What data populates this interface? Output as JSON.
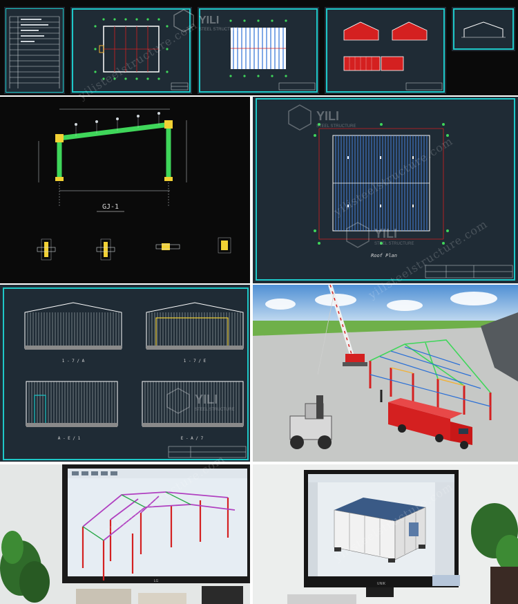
{
  "drawings": {
    "roof_plan_title": "Roof Plan",
    "frame_title": "GJ-1",
    "elevation_captions": [
      "1 - 7 / A",
      "1 - 7 / E",
      "A - E / 1",
      "E - A / 7"
    ]
  },
  "branding": {
    "logo_name": "YILI",
    "logo_sub": "STEEL STRUCTURE",
    "watermark_url": "yilisteelstructure.com"
  },
  "colors": {
    "cad_background": "#1f2b35",
    "frame_border": "#1ec8c8",
    "steel_red": "#d42020",
    "purlin_blue": "#2a6fd6",
    "grid_green": "#3fd65a"
  },
  "monitor": {
    "brand_left": "LG",
    "brand_right": "UNIK"
  }
}
